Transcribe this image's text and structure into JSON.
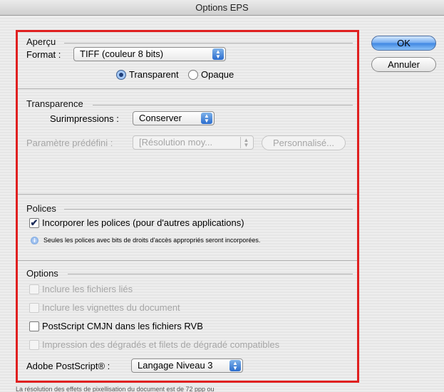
{
  "window": {
    "title": "Options EPS"
  },
  "buttons": {
    "ok": "OK",
    "cancel": "Annuler"
  },
  "apercu": {
    "section": "Aperçu",
    "format_label": "Format :",
    "format_value": "TIFF (couleur 8 bits)",
    "radio_transparent": "Transparent",
    "radio_opaque": "Opaque",
    "selected": "Transparent"
  },
  "transparence": {
    "section": "Transparence",
    "surimpressions_label": "Surimpressions :",
    "surimpressions_value": "Conserver",
    "preset_label": "Paramètre prédéfini :",
    "preset_value": "[Résolution moy...",
    "custom_button": "Personnalisé..."
  },
  "polices": {
    "section": "Polices",
    "embed_label": "Incorporer les polices (pour d'autres applications)",
    "embed_checked": true,
    "info_text": "Seules les polices avec bits de droits d'accès appropriés seront incorporées."
  },
  "options": {
    "section": "Options",
    "linked_files": "Inclure les fichiers liés",
    "thumbnails": "Inclure les vignettes du document",
    "cmyk_postscript": "PostScript CMJN dans les fichiers RVB",
    "gradient_print": "Impression des dégradés et filets de dégradé compatibles",
    "postscript_label": "Adobe PostScript® :",
    "postscript_value": "Langage Niveau 3"
  },
  "footer": {
    "note": "La résolution des effets de pixellisation du document est de 72 ppp ou"
  }
}
